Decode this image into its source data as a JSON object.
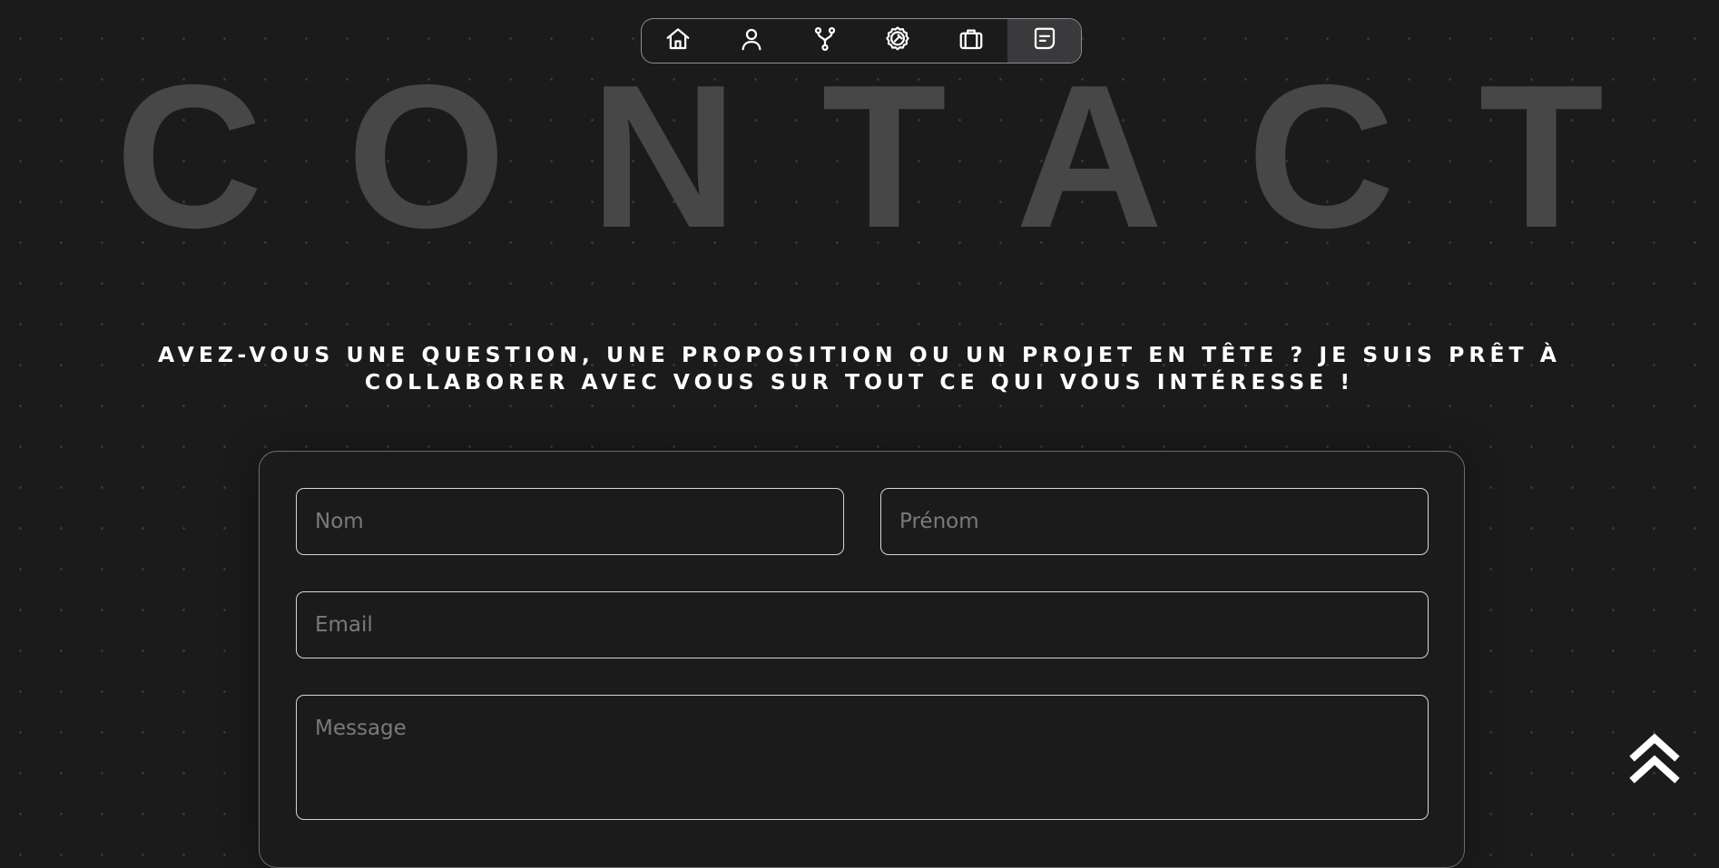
{
  "nav": {
    "items": [
      {
        "icon": "home-icon",
        "active": false
      },
      {
        "icon": "user-icon",
        "active": false
      },
      {
        "icon": "git-fork-icon",
        "active": false
      },
      {
        "icon": "skills-badge-icon",
        "active": false
      },
      {
        "icon": "briefcase-icon",
        "active": false
      },
      {
        "icon": "message-icon",
        "active": true
      }
    ]
  },
  "hero": {
    "title": "CONTACT"
  },
  "intro": {
    "text": "Avez-vous une question, une proposition ou un projet en tête ? Je suis prêt à collaborer avec vous sur tout ce qui vous intéresse !"
  },
  "form": {
    "nom_placeholder": "Nom",
    "prenom_placeholder": "Prénom",
    "email_placeholder": "Email",
    "message_placeholder": "Message"
  },
  "scroll_top": {
    "icon": "chevrons-up-icon"
  },
  "colors": {
    "background": "#1b1b1c",
    "hero_text": "#474748",
    "border": "#d6d6d8",
    "active_nav": "#3a3a3c"
  }
}
